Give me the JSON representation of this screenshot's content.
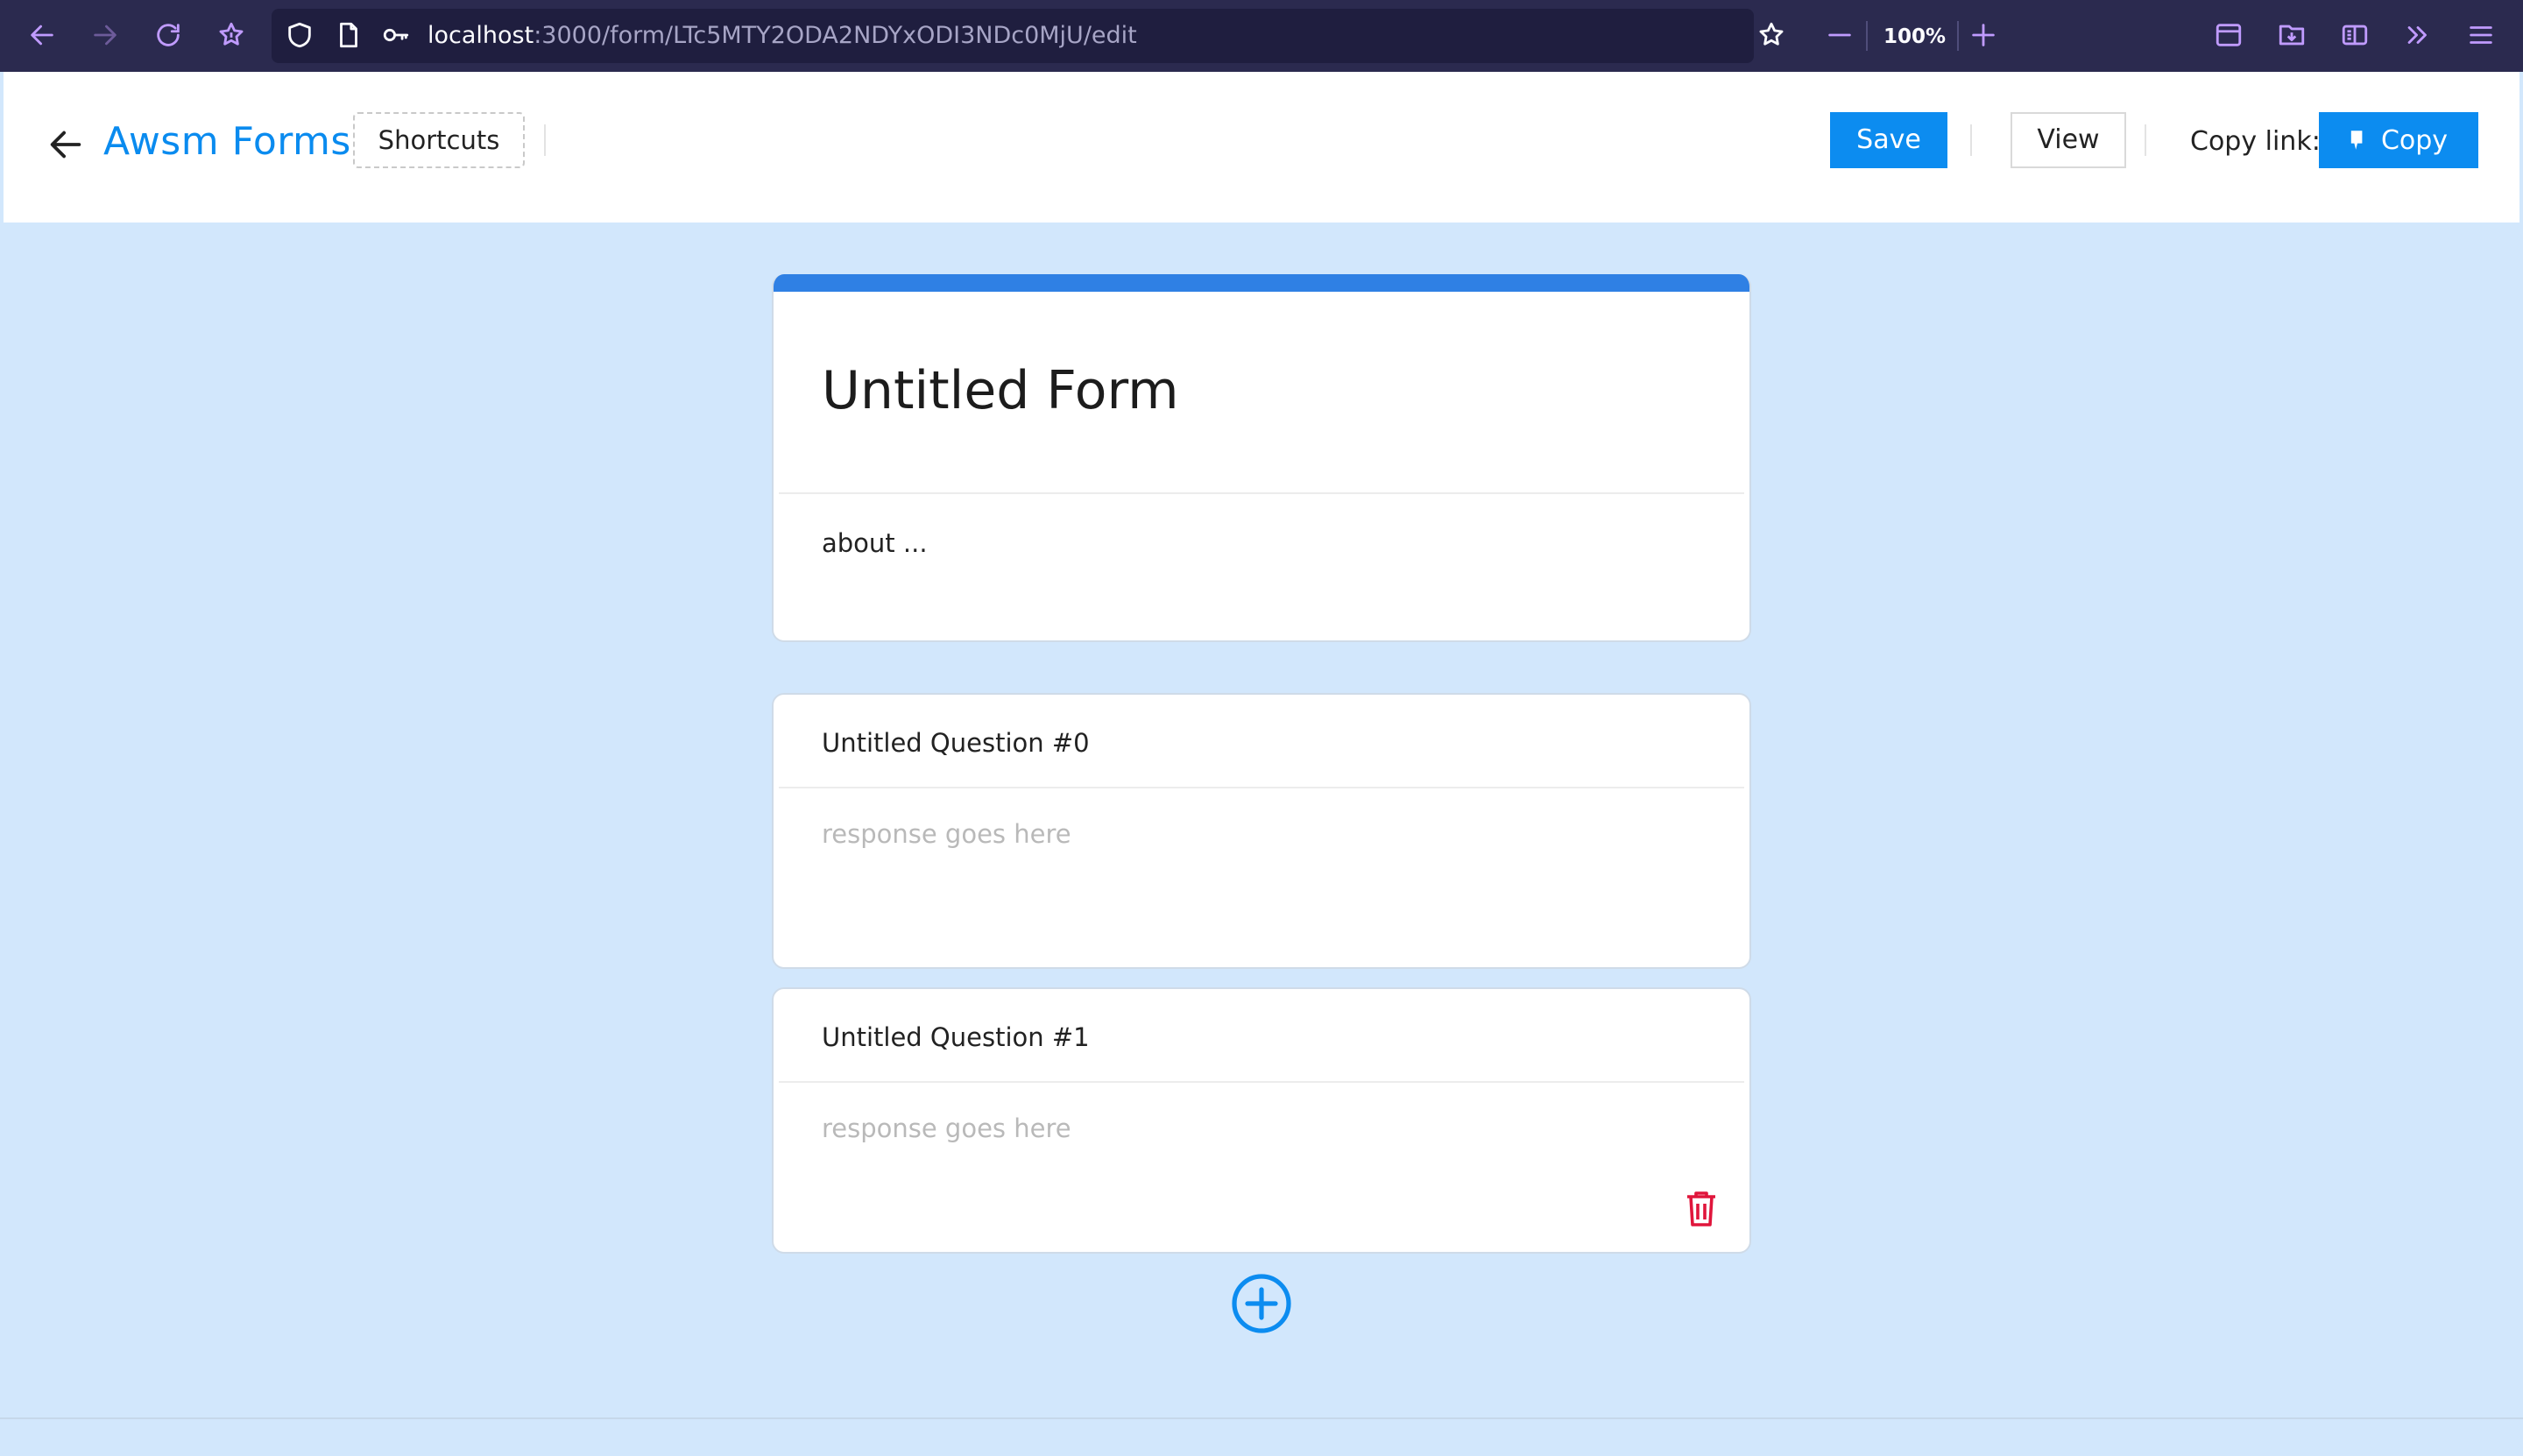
{
  "browser": {
    "url_host": "localhost",
    "url_path": ":3000/form/LTc5MTY2ODA2NDYxODI3NDc0MjU/edit",
    "zoom": "100%",
    "icons": [
      "back-arrow-icon",
      "forward-arrow-icon",
      "reload-icon",
      "pocket-icon",
      "shield-icon",
      "page-icon",
      "key-icon",
      "bookmark-star-icon",
      "zoom-out-icon",
      "zoom-in-icon",
      "sidebar-icon",
      "downloads-icon",
      "reader-icon",
      "overflow-icon",
      "menu-icon"
    ]
  },
  "header": {
    "brand": "Awsm Forms",
    "shortcuts_label": "Shortcuts",
    "save_label": "Save",
    "view_label": "View",
    "copy_link_label": "Copy link:",
    "copy_label": "Copy"
  },
  "form": {
    "title": "Untitled Form",
    "description": "about ...",
    "questions": [
      {
        "label": "Untitled Question #0",
        "placeholder": "response goes here"
      },
      {
        "label": "Untitled Question #1",
        "placeholder": "response goes here"
      }
    ]
  },
  "colors": {
    "browser_bg": "#2b2a4f",
    "accent_blue": "#0c8cf0",
    "title_bar": "#2f80e4",
    "page_bg": "#d2e7fc",
    "delete_red": "#e0163c",
    "browser_icon": "#c09bff"
  }
}
